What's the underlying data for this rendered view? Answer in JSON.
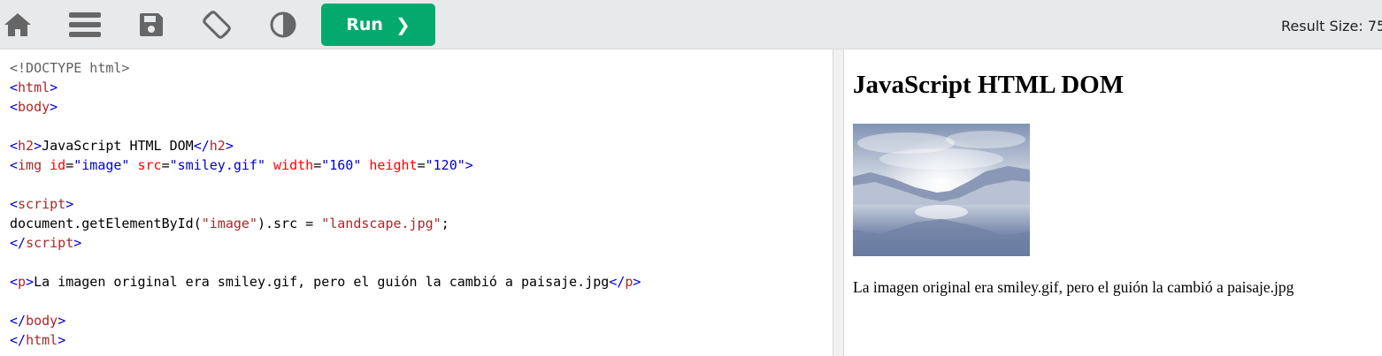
{
  "toolbar": {
    "icons": [
      "home-icon",
      "menu-icon",
      "save-icon",
      "rotate-icon",
      "theme-icon"
    ],
    "run_label": "Run",
    "result_size": "Result Size: 75"
  },
  "editor": {
    "doctype": "<!DOCTYPE html>",
    "script_stmt_prefix": "document.getElementById(",
    "script_arg": "\"image\"",
    "script_stmt_mid": ").src = ",
    "script_value": "\"landscape.jpg\"",
    "script_stmt_end": ";",
    "h2_text": "JavaScript HTML DOM",
    "img_attrs": [
      {
        "name": "id",
        "value": "\"image\""
      },
      {
        "name": "src",
        "value": "\"smiley.gif\""
      },
      {
        "name": "width",
        "value": "\"160\""
      },
      {
        "name": "height",
        "value": "\"120\""
      }
    ],
    "p_text": "La imagen original era smiley.gif, pero el guión la cambió a paisaje.jpg"
  },
  "result": {
    "heading": "JavaScript HTML DOM",
    "paragraph": "La imagen original era smiley.gif, pero el guión la cambió a paisaje.jpg"
  },
  "colors": {
    "toolbar_bg": "#e7e9eb",
    "run_green": "#04aa6d",
    "icon_gray": "#666666",
    "tag_color": "#a52a2a",
    "bracket_color": "#0000cd",
    "attr_color": "#ff0000"
  }
}
